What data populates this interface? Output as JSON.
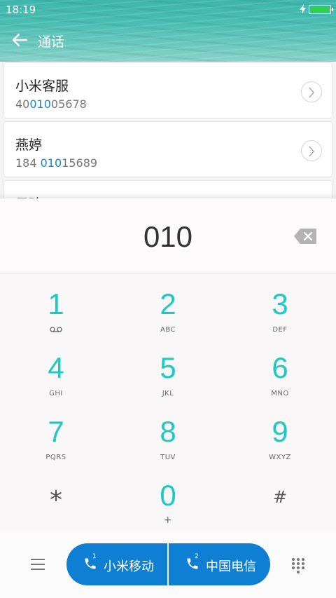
{
  "status": {
    "time": "18:19"
  },
  "header": {
    "title": "通话"
  },
  "contacts": [
    {
      "name": "小米客服",
      "num_pre": "40",
      "num_hl": "010",
      "num_post": "05678"
    },
    {
      "name": "燕婷",
      "num_pre": "184 ",
      "num_hl": "010",
      "num_post": "15689"
    },
    {
      "name": "子玲",
      "num_pre": "",
      "num_hl": "",
      "num_post": ""
    }
  ],
  "dialer": {
    "input": "010",
    "keys": [
      {
        "digit": "1",
        "letters": ""
      },
      {
        "digit": "2",
        "letters": "ABC"
      },
      {
        "digit": "3",
        "letters": "DEF"
      },
      {
        "digit": "4",
        "letters": "GHI"
      },
      {
        "digit": "5",
        "letters": "JKL"
      },
      {
        "digit": "6",
        "letters": "MNO"
      },
      {
        "digit": "7",
        "letters": "PQRS"
      },
      {
        "digit": "8",
        "letters": "TUV"
      },
      {
        "digit": "9",
        "letters": "WXYZ"
      },
      {
        "digit": "*",
        "letters": ""
      },
      {
        "digit": "0",
        "letters": "+"
      },
      {
        "digit": "#",
        "letters": ""
      }
    ]
  },
  "bottom": {
    "sim1_label": "小米移动",
    "sim1_index": "1",
    "sim2_label": "中国电信",
    "sim2_index": "2"
  },
  "colors": {
    "accent": "#1dc9c3",
    "call": "#0f7fd4",
    "highlight": "#1787d8",
    "header": "#49bdb2"
  },
  "icons": [
    "back-arrow-icon",
    "charging-bolt-icon",
    "battery-icon",
    "chevron-right-icon",
    "backspace-icon",
    "voicemail-icon",
    "phone-icon",
    "menu-icon",
    "dialpad-icon"
  ]
}
